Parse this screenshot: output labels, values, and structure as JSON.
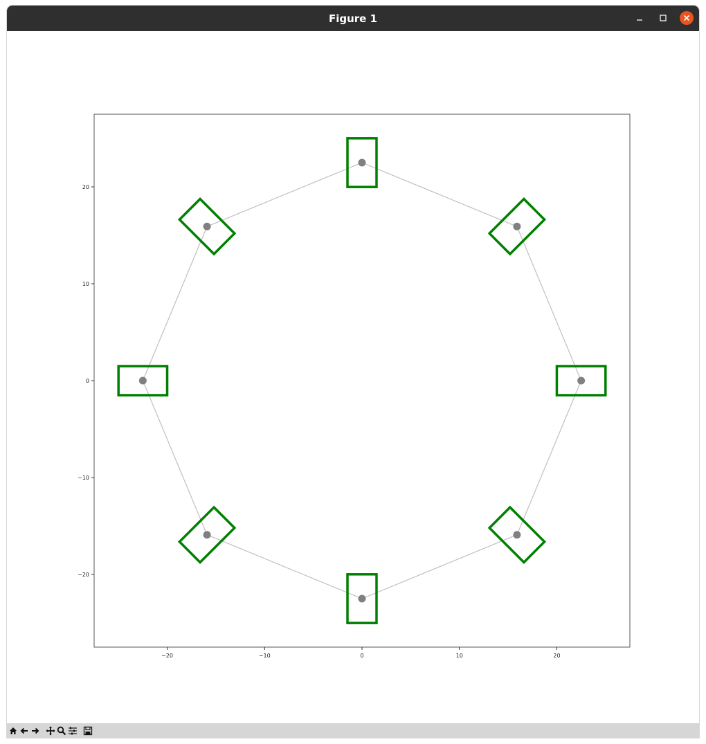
{
  "window": {
    "title": "Figure 1"
  },
  "titlebar_buttons": [
    {
      "name": "minimize-button",
      "icon": "minimize-icon"
    },
    {
      "name": "maximize-button",
      "icon": "maximize-icon"
    },
    {
      "name": "close-button",
      "icon": "close-icon",
      "color": "#e95420"
    }
  ],
  "toolbar": {
    "buttons": [
      {
        "name": "home-button",
        "icon": "home-icon"
      },
      {
        "name": "back-button",
        "icon": "back-arrow-icon"
      },
      {
        "name": "forward-button",
        "icon": "forward-arrow-icon"
      },
      {
        "name": "pan-button",
        "icon": "move-icon"
      },
      {
        "name": "zoom-button",
        "icon": "magnifier-icon"
      },
      {
        "name": "configure-subplots-button",
        "icon": "sliders-icon"
      },
      {
        "name": "save-button",
        "icon": "save-icon"
      }
    ]
  },
  "chart_data": {
    "type": "scatter",
    "title": "",
    "xlabel": "",
    "ylabel": "",
    "xlim": [
      -27.5,
      27.5
    ],
    "ylim": [
      -27.5,
      27.5
    ],
    "xticks": [
      -20,
      -10,
      0,
      10,
      20
    ],
    "yticks": [
      -20,
      -10,
      0,
      10,
      20
    ],
    "xtick_labels": [
      "−20",
      "−10",
      "0",
      "10",
      "20"
    ],
    "ytick_labels": [
      "−20",
      "−10",
      "0",
      "10",
      "20"
    ],
    "grid": false,
    "line_color": "#bfbfbf",
    "point_color": "#808080",
    "rect_color": "#008000",
    "points": [
      {
        "x": 22.5,
        "y": 0
      },
      {
        "x": 15.91,
        "y": 15.91
      },
      {
        "x": 0,
        "y": 22.5
      },
      {
        "x": -15.91,
        "y": 15.91
      },
      {
        "x": -22.5,
        "y": 0
      },
      {
        "x": -15.91,
        "y": -15.91
      },
      {
        "x": 0,
        "y": -22.5
      },
      {
        "x": 15.91,
        "y": -15.91
      }
    ],
    "rectangles": [
      {
        "cx": 22.5,
        "cy": 0,
        "width": 5,
        "height": 3,
        "angle": 0
      },
      {
        "cx": 15.91,
        "cy": 15.91,
        "width": 5,
        "height": 3,
        "angle": 45
      },
      {
        "cx": 0,
        "cy": 22.5,
        "width": 5,
        "height": 3,
        "angle": 90
      },
      {
        "cx": -15.91,
        "cy": 15.91,
        "width": 5,
        "height": 3,
        "angle": 135
      },
      {
        "cx": -22.5,
        "cy": 0,
        "width": 5,
        "height": 3,
        "angle": 180
      },
      {
        "cx": -15.91,
        "cy": -15.91,
        "width": 5,
        "height": 3,
        "angle": 225
      },
      {
        "cx": 0,
        "cy": -22.5,
        "width": 5,
        "height": 3,
        "angle": 270
      },
      {
        "cx": 15.91,
        "cy": -15.91,
        "width": 5,
        "height": 3,
        "angle": 315
      }
    ]
  }
}
